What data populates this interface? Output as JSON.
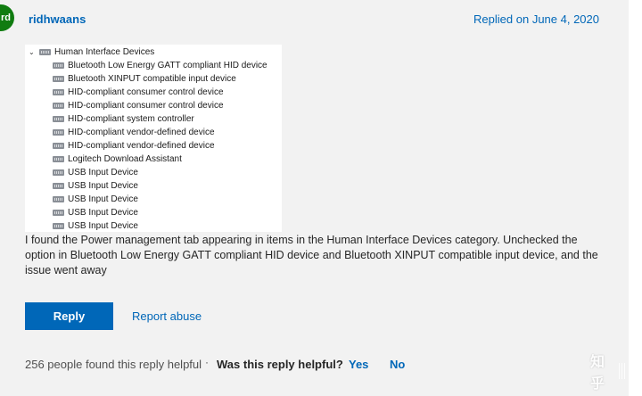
{
  "post": {
    "avatar_initials": "rd",
    "username": "ridhwaans",
    "replied_on": "Replied on June 4, 2020",
    "body": "I found the Power management tab appearing in items in the Human Interface Devices category. Unchecked the option in Bluetooth Low Energy GATT compliant HID device and Bluetooth XINPUT compatible input device, and the issue went away"
  },
  "device_tree": {
    "category": "Human Interface Devices",
    "items": [
      "Bluetooth Low Energy GATT compliant HID device",
      "Bluetooth XINPUT compatible input device",
      "HID-compliant consumer control device",
      "HID-compliant consumer control device",
      "HID-compliant system controller",
      "HID-compliant vendor-defined device",
      "HID-compliant vendor-defined device",
      "Logitech Download Assistant",
      "USB Input Device",
      "USB Input Device",
      "USB Input Device",
      "USB Input Device",
      "USB Input Device"
    ]
  },
  "actions": {
    "reply_label": "Reply",
    "report_label": "Report abuse"
  },
  "feedback": {
    "found_helpful": "256 people found this reply helpful",
    "separator": "·",
    "question": "Was this reply helpful?",
    "yes_label": "Yes",
    "no_label": "No"
  },
  "watermark": {
    "text": "知乎"
  },
  "colors": {
    "link": "#0067b8",
    "avatar": "#107c10",
    "background": "#f2f2f2"
  }
}
